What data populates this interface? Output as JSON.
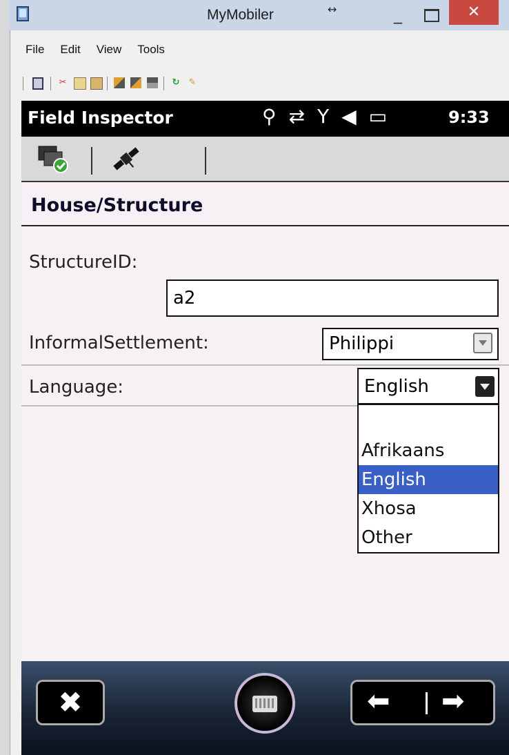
{
  "window": {
    "title": "MyMobiler",
    "resize_glyph": "↔",
    "minimize_glyph": "_",
    "close_glyph": "✕"
  },
  "menubar": {
    "items": [
      "File",
      "Edit",
      "View",
      "Tools"
    ]
  },
  "toolbar": {
    "icons": [
      "device-icon",
      "cut-icon",
      "copy-icon",
      "paste-icon",
      "copy-to-device-icon",
      "copy-from-device-icon",
      "sync-files-icon",
      "refresh-icon",
      "clean-icon"
    ]
  },
  "status_bar": {
    "app_name": "Field Inspector",
    "time": "9:33",
    "icons": [
      "location-icon",
      "data-transfer-icon",
      "no-signal-icon",
      "volume-icon",
      "battery-icon"
    ]
  },
  "app_bar": {
    "icons": [
      "sync-complete-icon",
      "satellite-icon"
    ]
  },
  "form": {
    "title": "House/Structure",
    "structure_id_label": "StructureID:",
    "structure_id_value": "a2",
    "informal_settlement_label": "InformalSettlement:",
    "informal_settlement_value": "Philippi",
    "language_label": "Language:",
    "language_value": "English",
    "language_options": [
      "",
      "Afrikaans",
      "English",
      "Xhosa",
      "Other"
    ],
    "language_selected_index": 2
  },
  "bottom_bar": {
    "close_glyph": "✖",
    "left_arrow": "⬅",
    "right_arrow": "➡"
  },
  "colors": {
    "selection": "#3a60c8",
    "close_button": "#c7493f",
    "status_bar": "#000000"
  }
}
